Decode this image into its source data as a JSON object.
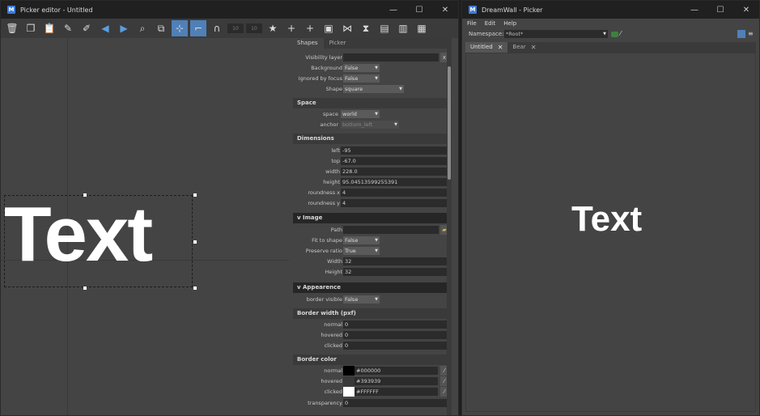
{
  "editor": {
    "title": "Picker editor - Untitled",
    "toolbar": {
      "field_a": "10",
      "field_b": "10"
    },
    "canvas_text": "Text",
    "tabs": [
      "Shapes",
      "Picker"
    ],
    "props": {
      "visibility_layer": {
        "label": "Visibility layer",
        "value": ""
      },
      "background": {
        "label": "Background",
        "value": "False"
      },
      "ignored_by_focus": {
        "label": "Ignored by focus",
        "value": "False"
      },
      "shape": {
        "label": "Shape",
        "value": "square"
      }
    },
    "space_section": {
      "title": "Space",
      "space": {
        "label": "space",
        "value": "world"
      },
      "anchor": {
        "label": "anchor",
        "value": "bottom_left"
      }
    },
    "dimensions": {
      "title": "Dimensions",
      "left": {
        "label": "left",
        "value": "-95"
      },
      "top": {
        "label": "top",
        "value": "-67.0"
      },
      "width": {
        "label": "width",
        "value": "228.0"
      },
      "height": {
        "label": "height",
        "value": "95.04513599255391"
      },
      "roundness_x": {
        "label": "roundness x",
        "value": "4"
      },
      "roundness_y": {
        "label": "roundness y",
        "value": "4"
      }
    },
    "image": {
      "title": "v Image",
      "path": {
        "label": "Path",
        "value": ""
      },
      "fit_to_shape": {
        "label": "Fit to shape",
        "value": "False"
      },
      "preserve_ratio": {
        "label": "Preserve ratio",
        "value": "True"
      },
      "width": {
        "label": "Width",
        "value": "32"
      },
      "height": {
        "label": "Height",
        "value": "32"
      }
    },
    "appearance": {
      "title": "v Appearence",
      "border_visible": {
        "label": "border visible",
        "value": "False"
      },
      "border_width_title": "Border width (pxf)",
      "bw_normal": {
        "label": "normal",
        "value": "0"
      },
      "bw_hovered": {
        "label": "hovered",
        "value": "0"
      },
      "bw_clicked": {
        "label": "clicked",
        "value": "0"
      },
      "border_color_title": "Border color",
      "bc_normal": {
        "label": "normal",
        "value": "#000000",
        "color": "#000000"
      },
      "bc_hovered": {
        "label": "hovered",
        "value": "#393939",
        "color": "#393939"
      },
      "bc_clicked": {
        "label": "clicked",
        "value": "#FFFFFF",
        "color": "#FFFFFF"
      },
      "transparency": {
        "label": "transparency",
        "value": "0"
      }
    }
  },
  "picker": {
    "title": "DreamWall - Picker",
    "menu": [
      "File",
      "Edit",
      "Help"
    ],
    "namespace_label": "Namespace:",
    "namespace_value": "*Root*",
    "tabs": [
      "Untitled",
      "Bear"
    ],
    "canvas_text": "Text"
  },
  "colors": {
    "accent": "#5080b8",
    "window_bg": "#444444",
    "titlebar": "#202020"
  }
}
